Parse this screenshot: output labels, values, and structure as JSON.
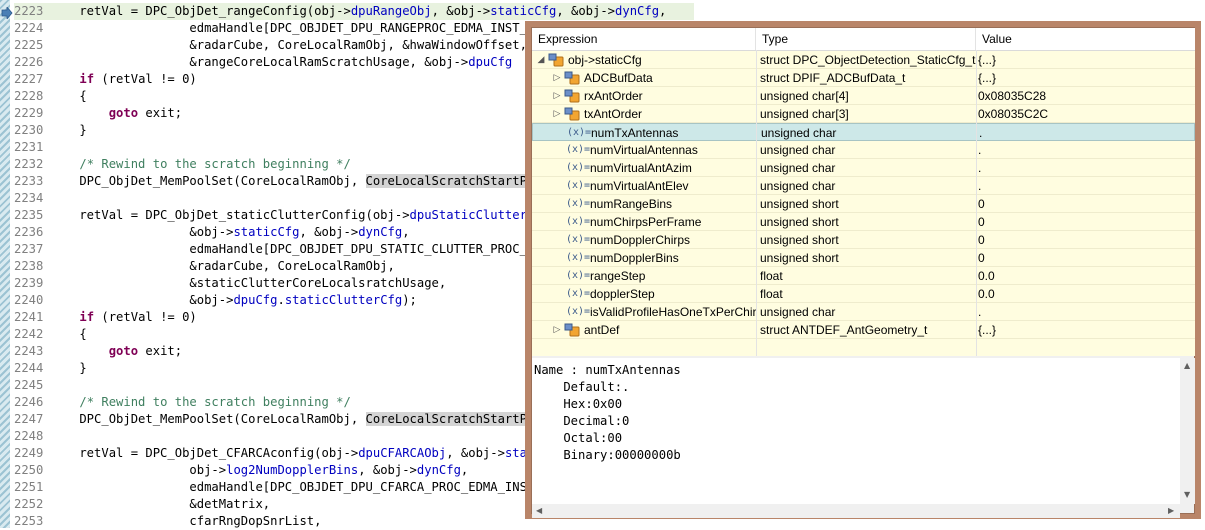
{
  "editor": {
    "lines": [
      {
        "num": "2223",
        "segments": [
          {
            "t": "    retVal = DPC_ObjDet_rangeConfig(obj->"
          },
          {
            "t": "dpuRangeObj",
            "c": "fld"
          },
          {
            "t": ", &obj->"
          },
          {
            "t": "staticCfg",
            "c": "fld"
          },
          {
            "t": ", &obj->"
          },
          {
            "t": "dynCfg",
            "c": "fld"
          },
          {
            "t": ","
          }
        ]
      },
      {
        "num": "2224",
        "segments": [
          {
            "t": "                   edmaHandle[DPC_OBJDET_DPU_RANGEPROC_EDMA_INST_ID],"
          }
        ]
      },
      {
        "num": "2225",
        "segments": [
          {
            "t": "                   &radarCube, CoreLocalRamObj, &hwaWindowOffset,"
          }
        ]
      },
      {
        "num": "2226",
        "segments": [
          {
            "t": "                   &rangeCoreLocalRamScratchUsage, &obj->"
          },
          {
            "t": "dpuCfg",
            "c": "fld"
          }
        ]
      },
      {
        "num": "2227",
        "segments": [
          {
            "t": "    "
          },
          {
            "t": "if",
            "c": "kw"
          },
          {
            "t": " (retVal != 0)"
          }
        ]
      },
      {
        "num": "2228",
        "segments": [
          {
            "t": "    {"
          }
        ]
      },
      {
        "num": "2229",
        "segments": [
          {
            "t": "        "
          },
          {
            "t": "goto",
            "c": "kw"
          },
          {
            "t": " exit;"
          }
        ]
      },
      {
        "num": "2230",
        "segments": [
          {
            "t": "    }"
          }
        ]
      },
      {
        "num": "2231",
        "segments": [
          {
            "t": ""
          }
        ]
      },
      {
        "num": "2232",
        "segments": [
          {
            "t": "    "
          },
          {
            "t": "/* Rewind to the scratch beginning */",
            "c": "cm"
          }
        ]
      },
      {
        "num": "2233",
        "segments": [
          {
            "t": "    DPC_ObjDet_MemPoolSet(CoreLocalRamObj, "
          },
          {
            "t": "CoreLocalScratchStartPoolAddr",
            "c": "hl"
          },
          {
            "t": ");"
          }
        ]
      },
      {
        "num": "2234",
        "segments": [
          {
            "t": ""
          }
        ]
      },
      {
        "num": "2235",
        "segments": [
          {
            "t": "    retVal = DPC_ObjDet_staticClutterConfig(obj->"
          },
          {
            "t": "dpuStaticClutterObj",
            "c": "fld"
          },
          {
            "t": ","
          }
        ]
      },
      {
        "num": "2236",
        "segments": [
          {
            "t": "                   &obj->"
          },
          {
            "t": "staticCfg",
            "c": "fld"
          },
          {
            "t": ", &obj->"
          },
          {
            "t": "dynCfg",
            "c": "fld"
          },
          {
            "t": ","
          }
        ]
      },
      {
        "num": "2237",
        "segments": [
          {
            "t": "                   edmaHandle[DPC_OBJDET_DPU_STATIC_CLUTTER_PROC_EDMA_INST_ID],"
          }
        ]
      },
      {
        "num": "2238",
        "segments": [
          {
            "t": "                   &radarCube, CoreLocalRamObj,"
          }
        ]
      },
      {
        "num": "2239",
        "segments": [
          {
            "t": "                   &staticClutterCoreLocalsratchUsage,"
          }
        ]
      },
      {
        "num": "2240",
        "segments": [
          {
            "t": "                   &obj->"
          },
          {
            "t": "dpuCfg",
            "c": "fld"
          },
          {
            "t": "."
          },
          {
            "t": "staticClutterCfg",
            "c": "fld"
          },
          {
            "t": ");"
          }
        ]
      },
      {
        "num": "2241",
        "segments": [
          {
            "t": "    "
          },
          {
            "t": "if",
            "c": "kw"
          },
          {
            "t": " (retVal != 0)"
          }
        ]
      },
      {
        "num": "2242",
        "segments": [
          {
            "t": "    {"
          }
        ]
      },
      {
        "num": "2243",
        "segments": [
          {
            "t": "        "
          },
          {
            "t": "goto",
            "c": "kw"
          },
          {
            "t": " exit;"
          }
        ]
      },
      {
        "num": "2244",
        "segments": [
          {
            "t": "    }"
          }
        ]
      },
      {
        "num": "2245",
        "segments": [
          {
            "t": ""
          }
        ]
      },
      {
        "num": "2246",
        "segments": [
          {
            "t": "    "
          },
          {
            "t": "/* Rewind to the scratch beginning */",
            "c": "cm"
          }
        ]
      },
      {
        "num": "2247",
        "segments": [
          {
            "t": "    DPC_ObjDet_MemPoolSet(CoreLocalRamObj, "
          },
          {
            "t": "CoreLocalScratchStartPoolAddr",
            "c": "hl"
          },
          {
            "t": ");"
          }
        ]
      },
      {
        "num": "2248",
        "segments": [
          {
            "t": ""
          }
        ]
      },
      {
        "num": "2249",
        "segments": [
          {
            "t": "    retVal = DPC_ObjDet_CFARCAconfig(obj->"
          },
          {
            "t": "dpuCFARCAObj",
            "c": "fld"
          },
          {
            "t": ", &obj->"
          },
          {
            "t": "staticCfg",
            "c": "fld"
          },
          {
            "t": ","
          }
        ]
      },
      {
        "num": "2250",
        "segments": [
          {
            "t": "                   obj->"
          },
          {
            "t": "log2NumDopplerBins",
            "c": "fld"
          },
          {
            "t": ", &obj->"
          },
          {
            "t": "dynCfg",
            "c": "fld"
          },
          {
            "t": ","
          }
        ]
      },
      {
        "num": "2251",
        "segments": [
          {
            "t": "                   edmaHandle[DPC_OBJDET_DPU_CFARCA_PROC_EDMA_INST_ID],"
          }
        ]
      },
      {
        "num": "2252",
        "segments": [
          {
            "t": "                   &detMatrix,"
          }
        ]
      },
      {
        "num": "2253",
        "segments": [
          {
            "t": "                   cfarRngDopSnrList,"
          }
        ]
      }
    ]
  },
  "popup": {
    "columns": {
      "expression": "Expression",
      "type": "Type",
      "value": "Value"
    },
    "rows": [
      {
        "indent": 0,
        "twisty": "expanded",
        "icon": "struct",
        "expr": "obj->staticCfg",
        "type": "struct DPC_ObjectDetection_StaticCfg_t",
        "value": "{...}"
      },
      {
        "indent": 1,
        "twisty": "collapsed",
        "icon": "struct",
        "expr": "ADCBufData",
        "type": "struct DPIF_ADCBufData_t",
        "value": "{...}"
      },
      {
        "indent": 1,
        "twisty": "collapsed",
        "icon": "struct",
        "expr": "rxAntOrder",
        "type": "unsigned char[4]",
        "value": "0x08035C28"
      },
      {
        "indent": 1,
        "twisty": "collapsed",
        "icon": "struct",
        "expr": "txAntOrder",
        "type": "unsigned char[3]",
        "value": "0x08035C2C"
      },
      {
        "indent": 1,
        "twisty": "none",
        "icon": "var",
        "expr": "numTxAntennas",
        "type": "unsigned char",
        "value": ".",
        "selected": true
      },
      {
        "indent": 1,
        "twisty": "none",
        "icon": "var",
        "expr": "numVirtualAntennas",
        "type": "unsigned char",
        "value": "."
      },
      {
        "indent": 1,
        "twisty": "none",
        "icon": "var",
        "expr": "numVirtualAntAzim",
        "type": "unsigned char",
        "value": "."
      },
      {
        "indent": 1,
        "twisty": "none",
        "icon": "var",
        "expr": "numVirtualAntElev",
        "type": "unsigned char",
        "value": "."
      },
      {
        "indent": 1,
        "twisty": "none",
        "icon": "var",
        "expr": "numRangeBins",
        "type": "unsigned short",
        "value": "0"
      },
      {
        "indent": 1,
        "twisty": "none",
        "icon": "var",
        "expr": "numChirpsPerFrame",
        "type": "unsigned short",
        "value": "0"
      },
      {
        "indent": 1,
        "twisty": "none",
        "icon": "var",
        "expr": "numDopplerChirps",
        "type": "unsigned short",
        "value": "0"
      },
      {
        "indent": 1,
        "twisty": "none",
        "icon": "var",
        "expr": "numDopplerBins",
        "type": "unsigned short",
        "value": "0"
      },
      {
        "indent": 1,
        "twisty": "none",
        "icon": "var",
        "expr": "rangeStep",
        "type": "float",
        "value": "0.0"
      },
      {
        "indent": 1,
        "twisty": "none",
        "icon": "var",
        "expr": "dopplerStep",
        "type": "float",
        "value": "0.0"
      },
      {
        "indent": 1,
        "twisty": "none",
        "icon": "var",
        "expr": "isValidProfileHasOneTxPerChir",
        "type": "unsigned char",
        "value": "."
      },
      {
        "indent": 1,
        "twisty": "collapsed",
        "icon": "struct",
        "expr": "antDef",
        "type": "struct ANTDEF_AntGeometry_t",
        "value": "{...}"
      }
    ],
    "var_icon_text": "(x)=",
    "details": [
      "Name : numTxAntennas",
      "    Default:.",
      "    Hex:0x00",
      "    Decimal:0",
      "    Octal:00",
      "    Binary:00000000b"
    ],
    "colors": {
      "frame": "#b98569",
      "row_bg": "#fffde0",
      "selected_bg": "#cde8e8"
    }
  }
}
